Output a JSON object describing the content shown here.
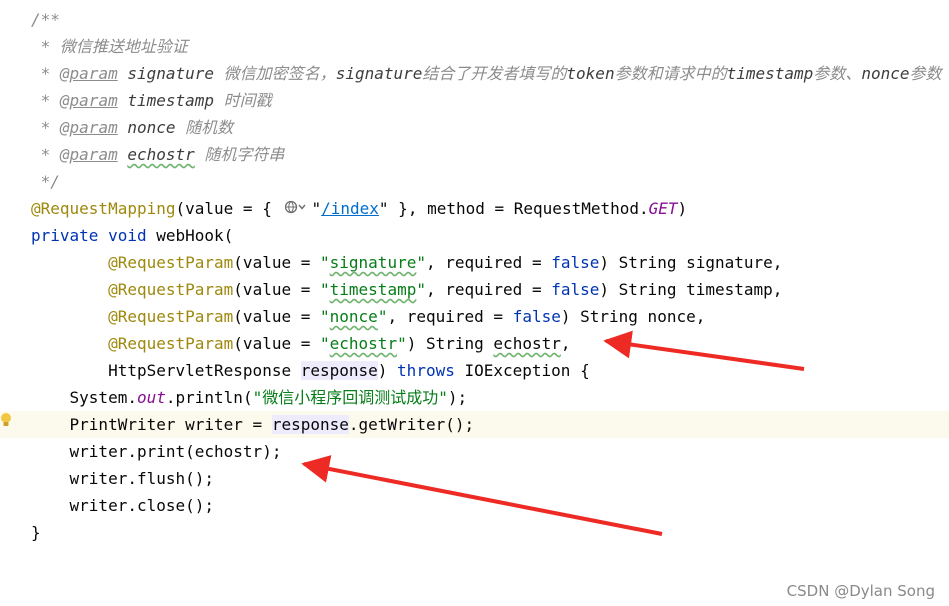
{
  "editor": {
    "lines": [
      {
        "indent": "/**",
        "tokens": []
      },
      {
        "indent": " ",
        "tokens": [
          {
            "t": "* 微信推送地址验证",
            "c": "comment"
          }
        ]
      },
      {
        "indent": " ",
        "tokens": [
          {
            "t": "* ",
            "c": "comment"
          },
          {
            "t": "@param",
            "c": "javadoc-tag"
          },
          {
            "t": " "
          },
          {
            "t": "signature",
            "c": "javadoc-param"
          },
          {
            "t": " 微信加密签名，",
            "c": "comment"
          },
          {
            "t": "signature",
            "c": "javadoc-param"
          },
          {
            "t": "结合了开发者填写的",
            "c": "comment"
          },
          {
            "t": "token",
            "c": "javadoc-param"
          },
          {
            "t": "参数和请求中的",
            "c": "comment"
          },
          {
            "t": "timestamp",
            "c": "javadoc-param"
          },
          {
            "t": "参数、",
            "c": "comment"
          },
          {
            "t": "nonce",
            "c": "javadoc-param"
          },
          {
            "t": "参数",
            "c": "comment"
          }
        ]
      },
      {
        "indent": " ",
        "tokens": [
          {
            "t": "* ",
            "c": "comment"
          },
          {
            "t": "@param",
            "c": "javadoc-tag"
          },
          {
            "t": " "
          },
          {
            "t": "timestamp",
            "c": "javadoc-param"
          },
          {
            "t": " 时间戳",
            "c": "comment"
          }
        ]
      },
      {
        "indent": " ",
        "tokens": [
          {
            "t": "* ",
            "c": "comment"
          },
          {
            "t": "@param",
            "c": "javadoc-tag"
          },
          {
            "t": " "
          },
          {
            "t": "nonce",
            "c": "javadoc-param"
          },
          {
            "t": " 随机数",
            "c": "comment"
          }
        ]
      },
      {
        "indent": " ",
        "tokens": [
          {
            "t": "* ",
            "c": "comment"
          },
          {
            "t": "@param",
            "c": "javadoc-tag"
          },
          {
            "t": " "
          },
          {
            "t": "echostr",
            "c": "javadoc-param typo"
          },
          {
            "t": " 随机字符串",
            "c": "comment"
          }
        ]
      },
      {
        "indent": " ",
        "tokens": [
          {
            "t": "*/",
            "c": "comment"
          }
        ]
      },
      {
        "indent": "",
        "tokens": [
          {
            "t": "@RequestMapping",
            "c": "annotation"
          },
          {
            "t": "(value = { "
          },
          {
            "inlay": "globe-chevron"
          },
          {
            "t": "\""
          },
          {
            "t": "/index",
            "c": "link"
          },
          {
            "t": "\""
          },
          {
            "t": " }, method = RequestMethod."
          },
          {
            "t": "GET",
            "c": "enum"
          },
          {
            "t": ")"
          }
        ]
      },
      {
        "indent": "",
        "tokens": [
          {
            "t": "private",
            "c": "keyword"
          },
          {
            "t": " "
          },
          {
            "t": "void",
            "c": "keyword"
          },
          {
            "t": " webHook("
          }
        ]
      },
      {
        "indent": "        ",
        "tokens": [
          {
            "t": "@RequestParam",
            "c": "annotation"
          },
          {
            "t": "(value = "
          },
          {
            "t": "\"",
            "c": "string"
          },
          {
            "t": "signature",
            "c": "string typo"
          },
          {
            "t": "\"",
            "c": "string"
          },
          {
            "t": ", required = "
          },
          {
            "t": "false",
            "c": "keyword"
          },
          {
            "t": ") String signature,"
          }
        ]
      },
      {
        "indent": "        ",
        "tokens": [
          {
            "t": "@RequestParam",
            "c": "annotation"
          },
          {
            "t": "(value = "
          },
          {
            "t": "\"",
            "c": "string"
          },
          {
            "t": "timestamp",
            "c": "string typo"
          },
          {
            "t": "\"",
            "c": "string"
          },
          {
            "t": ", required = "
          },
          {
            "t": "false",
            "c": "keyword"
          },
          {
            "t": ") String timestamp,"
          }
        ]
      },
      {
        "indent": "        ",
        "tokens": [
          {
            "t": "@RequestParam",
            "c": "annotation"
          },
          {
            "t": "(value = "
          },
          {
            "t": "\"",
            "c": "string"
          },
          {
            "t": "nonce",
            "c": "string typo"
          },
          {
            "t": "\"",
            "c": "string"
          },
          {
            "t": ", required = "
          },
          {
            "t": "false",
            "c": "keyword"
          },
          {
            "t": ") String nonce,"
          }
        ]
      },
      {
        "indent": "        ",
        "tokens": [
          {
            "t": "@RequestParam",
            "c": "annotation"
          },
          {
            "t": "(value = "
          },
          {
            "t": "\"",
            "c": "string"
          },
          {
            "t": "echostr",
            "c": "string typo"
          },
          {
            "t": "\"",
            "c": "string"
          },
          {
            "t": ") String "
          },
          {
            "t": "echostr",
            "c": "typo"
          },
          {
            "t": ","
          }
        ]
      },
      {
        "indent": "        ",
        "tokens": [
          {
            "t": "HttpServletResponse "
          },
          {
            "t": "response",
            "c": "hl-usage"
          },
          {
            "t": ") "
          },
          {
            "t": "throws",
            "c": "keyword"
          },
          {
            "t": " IOException {"
          }
        ]
      },
      {
        "indent": "    ",
        "tokens": [
          {
            "t": "System."
          },
          {
            "t": "out",
            "c": "static"
          },
          {
            "t": ".println("
          },
          {
            "t": "\"微信小程序回调测试成功\"",
            "c": "string"
          },
          {
            "t": ");"
          }
        ]
      },
      {
        "indent": "    ",
        "highlighted": true,
        "tokens": [
          {
            "t": "PrintWriter writer = "
          },
          {
            "t": "response",
            "c": "hl-usage"
          },
          {
            "t": ".getWriter();"
          }
        ]
      },
      {
        "indent": "    ",
        "tokens": [
          {
            "t": "writer.print(echostr);"
          }
        ]
      },
      {
        "indent": "    ",
        "tokens": [
          {
            "t": "writer.flush();"
          }
        ]
      },
      {
        "indent": "    ",
        "tokens": [
          {
            "t": "writer.close();"
          }
        ]
      },
      {
        "indent": "",
        "tokens": [
          {
            "t": "}"
          }
        ]
      }
    ]
  },
  "colors": {
    "background": "#ffffff",
    "current_line": "#fcfaed",
    "arrow": "#ee2a24",
    "bulb": "#f2c744"
  },
  "icons": {
    "bulb": "intention-bulb-icon",
    "inlay": "globe-dropdown-icon"
  },
  "watermark": {
    "text": "CSDN @Dylan  Song"
  }
}
